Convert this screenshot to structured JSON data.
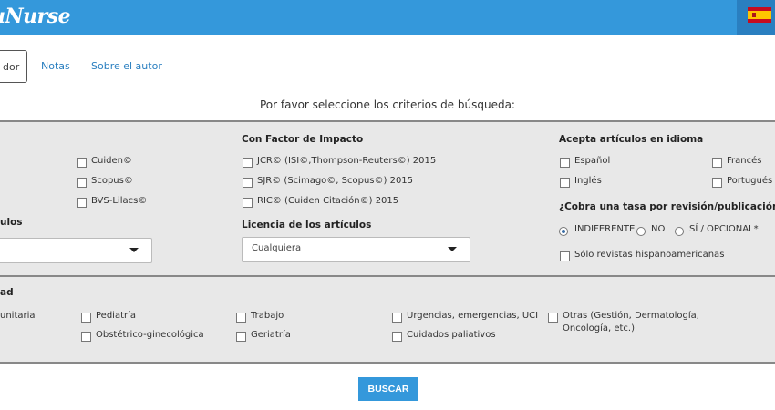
{
  "header": {
    "brand": "uNurse",
    "flag_icon": "spain-flag-icon",
    "color": "#3498db"
  },
  "tabs": [
    {
      "label": "dor",
      "active": true
    },
    {
      "label": "Notas",
      "active": false
    },
    {
      "label": "Sobre el autor",
      "active": false
    }
  ],
  "prompt": "Por favor seleccione los criterios de búsqueda:",
  "panel1": {
    "indexes": [
      "Cuiden©",
      "Scopus©",
      "BVS-Lilacs©"
    ],
    "articles_header_fragment": "ulos",
    "impact": {
      "header": "Con Factor de Impacto",
      "options": [
        "JCR© (ISI©,Thompson-Reuters©) 2015",
        "SJR© (Scimago©, Scopus©) 2015",
        "RIC© (Cuiden Citación©) 2015"
      ]
    },
    "license": {
      "header": "Licencia de los artículos",
      "selected": "Cualquiera"
    },
    "languages": {
      "header": "Acepta artículos en idioma",
      "options": [
        "Español",
        "Francés",
        "Inglés",
        "Portugués"
      ]
    },
    "fee": {
      "header": "¿Cobra una tasa por revisión/publicación?",
      "options": [
        "INDIFERENTE",
        "NO",
        "SÍ / OPCIONAL*"
      ],
      "selected": "INDIFERENTE"
    },
    "hispano": "Sólo revistas hispanoamericanas"
  },
  "panel2": {
    "header_fragment": "ad",
    "specialties": {
      "col0": "unitaria",
      "pediatria": "Pediatría",
      "obstetrico": "Obstétrico-ginecológica",
      "trabajo": "Trabajo",
      "geriatria": "Geriatría",
      "urgencias": "Urgencias, emergencias, UCI",
      "paliativos": "Cuidados paliativos",
      "otras_1": "Otras (Gestión, Dermatología,",
      "otras_2": "Oncología, etc.)"
    }
  },
  "search_button": "BUSCAR"
}
